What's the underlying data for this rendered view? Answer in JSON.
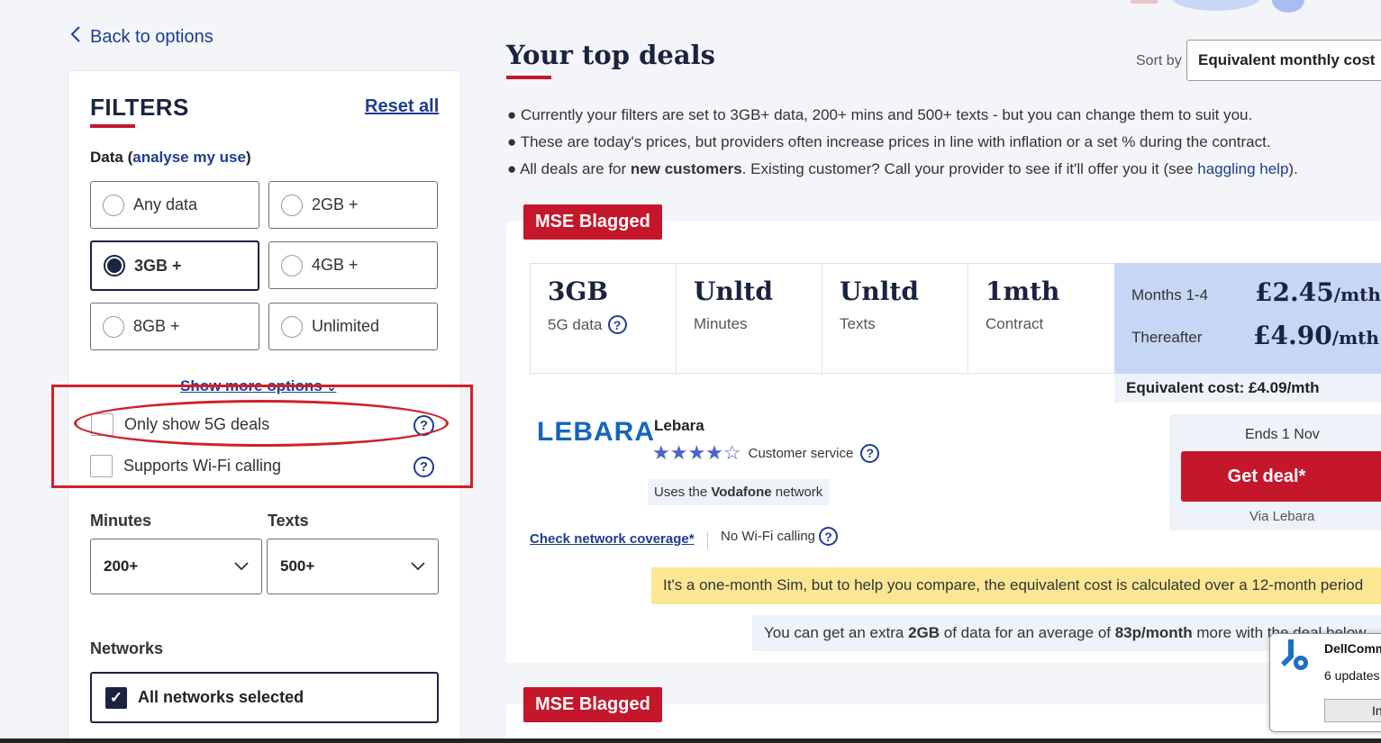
{
  "nav": {
    "back_label": "Back to options"
  },
  "filters": {
    "title": "FILTERS",
    "reset_label": "Reset all",
    "data_label": "Data (",
    "data_link": "analyse my use",
    "data_label_end": ")",
    "data_options": [
      "Any data",
      "2GB +",
      "3GB +",
      "4GB +",
      "8GB +",
      "Unlimited"
    ],
    "selected_data": "3GB +",
    "show_more": "Show more options",
    "only_5g": "Only show 5G deals",
    "wifi_calling": "Supports Wi-Fi calling",
    "minutes_label": "Minutes",
    "minutes_value": "200+",
    "texts_label": "Texts",
    "texts_value": "500+",
    "networks_label": "Networks",
    "networks_value": "All networks selected"
  },
  "main": {
    "title": "Your top deals",
    "sort_label": "Sort by",
    "sort_value": "Equivalent monthly cost",
    "bullets": {
      "b1": "Currently your filters are set to 3GB+ data, 200+ mins and 500+ texts - but you can change them to suit you.",
      "b2": "These are today's prices, but providers often increase prices in line with inflation or a set % during the contract.",
      "b3_pre": "All deals are for ",
      "b3_bold": "new customers",
      "b3_mid": ". Existing customer? Call your provider to see if it'll offer you it (see ",
      "b3_link": "haggling help",
      "b3_end": ")."
    }
  },
  "deal": {
    "badge": "MSE Blagged",
    "data_big": "3GB",
    "data_sub": "5G data",
    "minutes_big": "Unltd",
    "minutes_sub": "Minutes",
    "texts_big": "Unltd",
    "texts_sub": "Texts",
    "contract_big": "1mth",
    "contract_sub": "Contract",
    "price1_label": "Months 1-4",
    "price1_value": "£2.45",
    "price_unit": "/mth",
    "price2_label": "Thereafter",
    "price2_value": "£4.90",
    "equivalent": "Equivalent cost: £4.09/mth",
    "logo": "LEBARA",
    "provider": "Lebara",
    "rating": 4,
    "rating_max": 5,
    "customer_service": "Customer service",
    "network_pre": "Uses the ",
    "network_name": "Vodafone",
    "network_post": " network",
    "check_coverage": "Check network coverage*",
    "wifi": "No Wi-Fi calling",
    "ends": "Ends 1 Nov",
    "get_deal": "Get deal*",
    "via": "Via Lebara",
    "notice": "It's a one-month Sim, but to help you compare, the equivalent cost is calculated over a 12-month period",
    "extra_pre": "You can get an extra ",
    "extra_data": "2GB",
    "extra_mid": " of data for an average of ",
    "extra_price": "83p/month",
    "extra_post": " more with the deal below"
  },
  "deal2": {
    "badge": "MSE Blagged"
  },
  "popup": {
    "title": "DellComm",
    "text": "6 updates",
    "button": "In"
  },
  "colors": {
    "brand_red": "#c4172c",
    "navy": "#1a2340",
    "link": "#1e3d8f",
    "annotation": "#d1202a"
  }
}
